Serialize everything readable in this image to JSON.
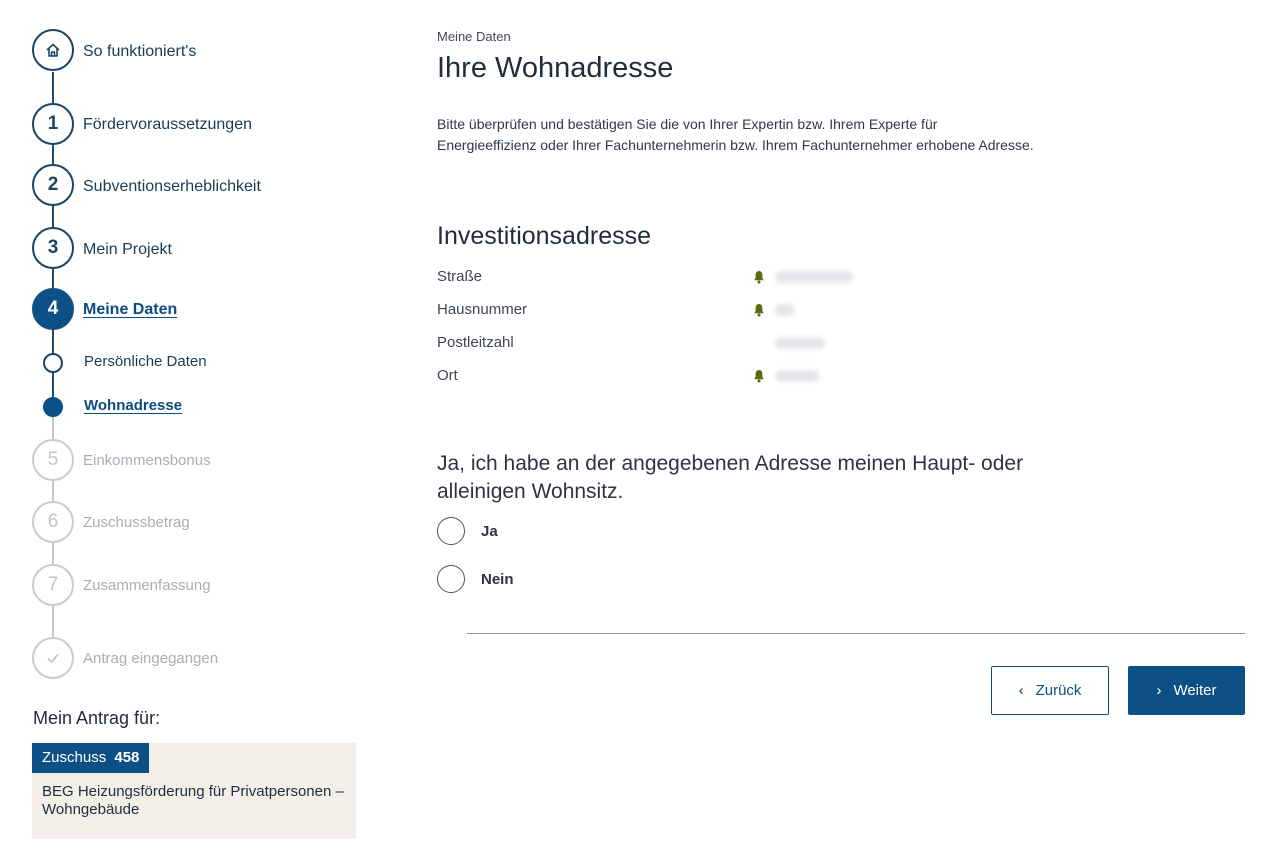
{
  "sidebar": {
    "home": {
      "label": "So funktioniert's"
    },
    "steps": [
      {
        "number": "1",
        "label": "Fördervoraussetzungen"
      },
      {
        "number": "2",
        "label": "Subventionserheblichkeit"
      },
      {
        "number": "3",
        "label": "Mein Projekt"
      },
      {
        "number": "4",
        "label": "Meine Daten"
      },
      {
        "number": "5",
        "label": "Einkommensbonus"
      },
      {
        "number": "6",
        "label": "Zuschussbetrag"
      },
      {
        "number": "7",
        "label": "Zusammenfassung"
      }
    ],
    "substeps": [
      {
        "label": "Persönliche Daten"
      },
      {
        "label": "Wohnadresse"
      }
    ],
    "final_step": {
      "label": "Antrag eingegangen"
    },
    "antrag": {
      "heading": "Mein Antrag für:",
      "badge_prefix": "Zuschuss",
      "badge_number": "458",
      "description": "BEG Heizungsförderung für Privatpersonen – Wohngebäude"
    }
  },
  "main": {
    "overline": "Meine Daten",
    "title": "Ihre Wohnadresse",
    "intro": "Bitte überprüfen und bestätigen Sie die von Ihrer Expertin bzw. Ihrem Experte für Energieeffizienz oder Ihrer Fachunternehmerin bzw. Ihrem Fachunternehmer erhobene Adresse.",
    "section_title": "Investitionsadresse",
    "address_fields": [
      {
        "label": "Straße"
      },
      {
        "label": "Hausnummer"
      },
      {
        "label": "Postleitzahl"
      },
      {
        "label": "Ort"
      }
    ],
    "question": "Ja, ich habe an der angegebenen Adresse meinen Haupt- oder alleinigen Wohnsitz.",
    "options": [
      {
        "label": "Ja"
      },
      {
        "label": "Nein"
      }
    ],
    "buttons": {
      "back": "Zurück",
      "next": "Weiter"
    }
  },
  "icons": {
    "home": "house-icon",
    "check": "check-icon",
    "address_marker": "bell-icon",
    "back": "chevron-left-icon",
    "next": "chevron-right-icon"
  },
  "colors": {
    "primary": "#0c5085",
    "navy": "#1b4566",
    "disabled": "#c8ccd0",
    "marker": "#5a6b10",
    "antrag_bg": "#f2efe9"
  }
}
